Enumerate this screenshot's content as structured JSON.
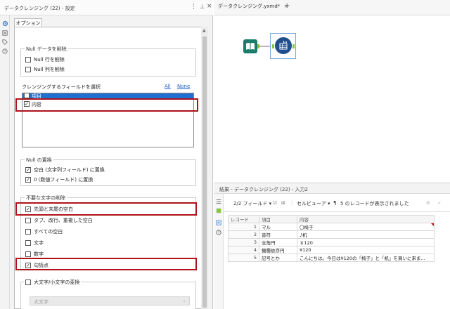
{
  "config_panel": {
    "title": "データクレンジング (22) - 設定",
    "tab": "オプション",
    "null_remove": {
      "title": "Null データを削除",
      "items": [
        {
          "label": "Null 行を削除",
          "checked": false
        },
        {
          "label": "Null 列を削除",
          "checked": false
        }
      ]
    },
    "field_select": {
      "title": "クレンジングするフィールドを選択",
      "all_label": "All",
      "none_label": "None",
      "items": [
        {
          "label": "項目",
          "checked": false
        },
        {
          "label": "内容",
          "checked": true
        }
      ]
    },
    "null_replace": {
      "title": "Null の置換",
      "items": [
        {
          "label": "空白 (文字列フィールド) に置換",
          "checked": true
        },
        {
          "label": "0 (数値フィールド) に置換",
          "checked": true
        }
      ]
    },
    "remove_chars": {
      "title": "不要な文字の削除",
      "items": [
        {
          "label": "先頭と末尾の空白",
          "checked": true
        },
        {
          "label": "タブ、改行、重複した空白",
          "checked": false
        },
        {
          "label": "すべての空白",
          "checked": false
        },
        {
          "label": "文字",
          "checked": false
        },
        {
          "label": "数字",
          "checked": false
        },
        {
          "label": "句読点",
          "checked": true
        }
      ]
    },
    "case_convert": {
      "label": "大文字/小文字の変換",
      "checked": false,
      "select_value": "大文字"
    }
  },
  "workflow": {
    "tab_label": "データクレンジング.yxmd*",
    "close_glyph": "×",
    "add_glyph": "+"
  },
  "results": {
    "title": "結果 - データクレンジング (22) - 入力2",
    "fields_label": "2/2 フィールド",
    "cell_viewer_label": "セルビューア",
    "records_message": "5 のレコードが表示されました",
    "columns": [
      "レコード",
      "項目",
      "内容"
    ],
    "rows": [
      {
        "n": "1",
        "item": "マル",
        "content": "〇椅子"
      },
      {
        "n": "2",
        "item": "音符",
        "content": "♪机"
      },
      {
        "n": "3",
        "item": "全角円",
        "content": "￥120"
      },
      {
        "n": "4",
        "item": "機種依存円",
        "content": "¥120"
      },
      {
        "n": "5",
        "item": "記号とか",
        "content": "こんにちは。今日は¥120の「椅子」と「机」を買いに来ま..."
      }
    ]
  },
  "colors": {
    "highlight": "#b0121b",
    "selection": "#1f6fd0",
    "node_input": "#1a7d6b",
    "node_cleanse": "#1f4f8c",
    "anchor": "#8cc63f"
  }
}
